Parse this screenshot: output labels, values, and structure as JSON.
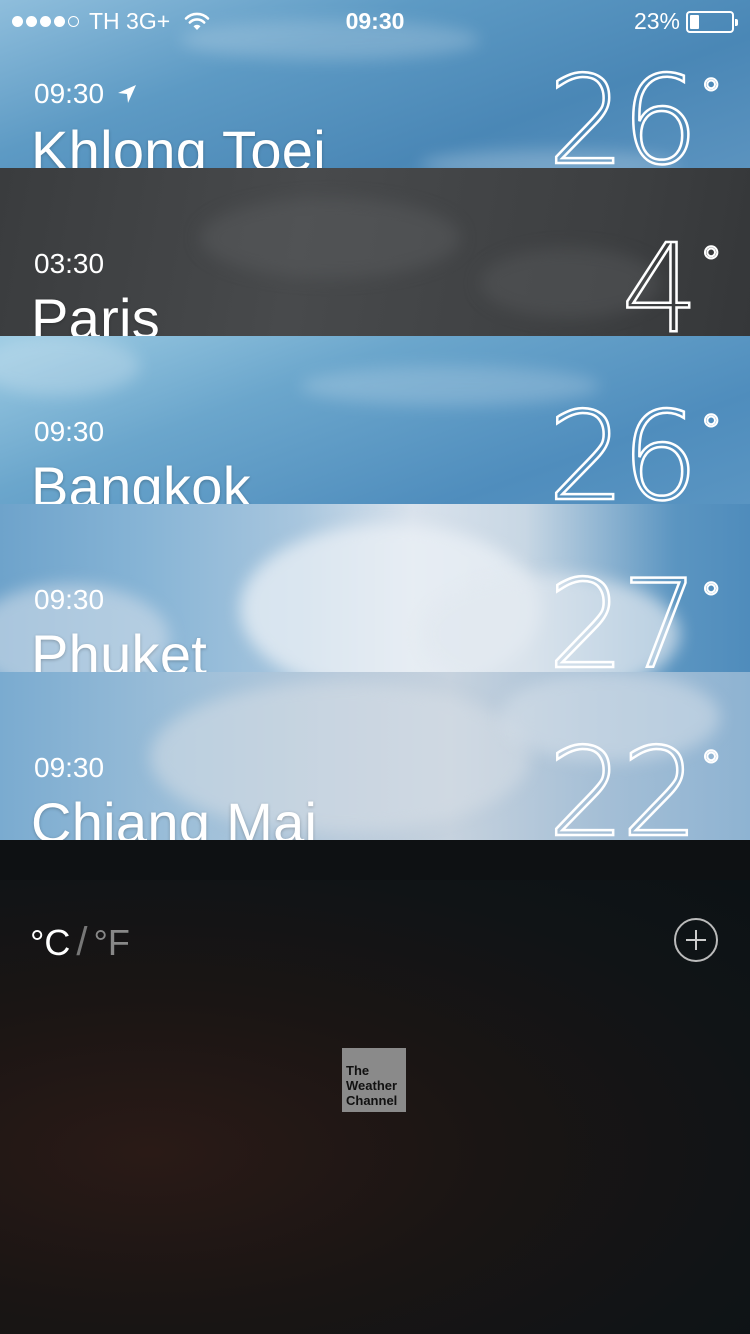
{
  "status_bar": {
    "carrier": "TH 3G+",
    "time": "09:30",
    "battery_percent": "23%",
    "battery_level": 0.23,
    "signal_bars_filled": 4,
    "signal_bars_total": 5
  },
  "cities": [
    {
      "time": "09:30",
      "name": "Khlong Toei",
      "temp": "26",
      "degree": "°",
      "current_location": true
    },
    {
      "time": "03:30",
      "name": "Paris",
      "temp": "4",
      "degree": "°",
      "current_location": false
    },
    {
      "time": "09:30",
      "name": "Bangkok",
      "temp": "26",
      "degree": "°",
      "current_location": false
    },
    {
      "time": "09:30",
      "name": "Phuket",
      "temp": "27",
      "degree": "°",
      "current_location": false
    },
    {
      "time": "09:30",
      "name": "Chiang Mai",
      "temp": "22",
      "degree": "°",
      "current_location": false
    }
  ],
  "footer": {
    "unit_celsius": "°C",
    "unit_separator": "/",
    "unit_fahrenheit": "°F",
    "logo_line1": "The",
    "logo_line2": "Weather",
    "logo_line3": "Channel"
  },
  "icons": {
    "location": "location-arrow-icon",
    "add": "plus-circle-icon",
    "wifi": "wifi-icon",
    "battery": "battery-icon"
  }
}
